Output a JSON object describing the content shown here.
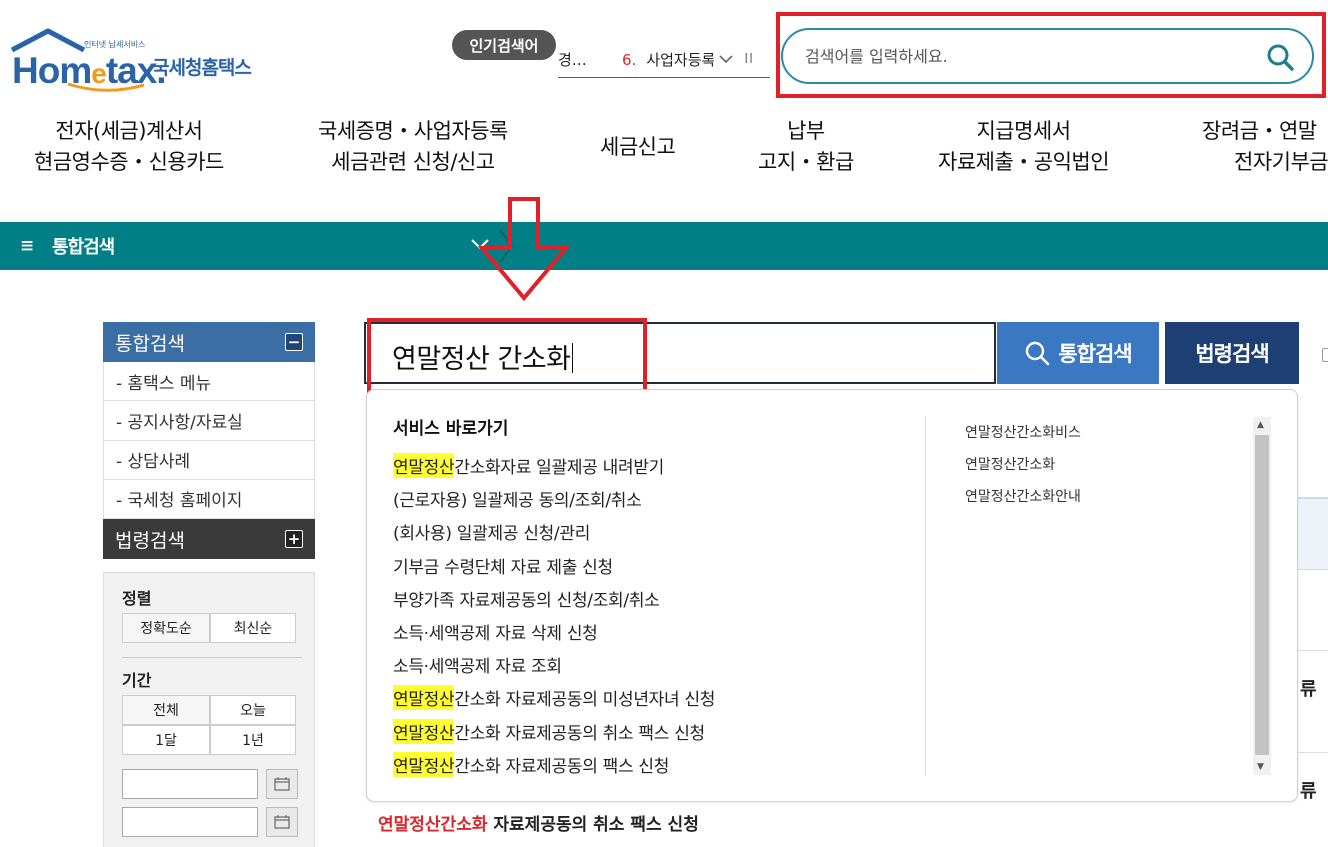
{
  "colors": {
    "brand_blue": "#2a63a8",
    "teal": "#007f86",
    "highlight": "#ffff30",
    "annotation_red": "#e02127"
  },
  "logo": {
    "tagline": "인터넷 납세서비스",
    "wordmark_pre": "Hom",
    "wordmark_e": "e",
    "wordmark_post": "tax.",
    "korean": "국세청홈택스"
  },
  "popular": {
    "badge": "인기검색어",
    "prev_fragment": "경…",
    "rank": "6.",
    "keyword": "사업자등록",
    "pause_label": "II"
  },
  "top_search": {
    "placeholder": "검색어를 입력하세요.",
    "icon": "search-icon"
  },
  "gnb": [
    {
      "line1": "전자(세금)계산서",
      "line2": "현금영수증・신용카드"
    },
    {
      "line1": "국세증명・사업자등록",
      "line2": "세금관련 신청/신고"
    },
    {
      "line1": "세금신고",
      "line2": ""
    },
    {
      "line1": "납부",
      "line2": "고지・환급"
    },
    {
      "line1": "지급명세서",
      "line2": "자료제출・공익법인"
    },
    {
      "line1": "장려금・연말",
      "line2": "전자기부금"
    }
  ],
  "teal_bar": {
    "menu_icon": "≡",
    "title": "통합검색"
  },
  "left_panel": {
    "section1_title": "통합검색",
    "section1_toggle": "−",
    "section1_items": [
      "- 홈택스 메뉴",
      "- 공지사항/자료실",
      "- 상담사례",
      "- 국세청 홈페이지"
    ],
    "section2_title": "법령검색",
    "section2_toggle": "+",
    "sort_label": "정렬",
    "sort_options": [
      "정확도순",
      "최신순"
    ],
    "period_label": "기간",
    "period_options": [
      "전체",
      "오늘",
      "1달",
      "1년"
    ]
  },
  "main_search": {
    "value": "연말정산 간소화",
    "total_search_label": "통합검색",
    "law_search_label": "법령검색"
  },
  "dropdown": {
    "title": "서비스 바로가기",
    "items": [
      {
        "mark": "연말정산",
        "rest": " 간소화자료 일괄제공 내려받기"
      },
      {
        "mark": "",
        "rest": "(근로자용) 일괄제공 동의/조회/취소"
      },
      {
        "mark": "",
        "rest": "(회사용) 일괄제공 신청/관리"
      },
      {
        "mark": "",
        "rest": "기부금 수령단체 자료 제출 신청"
      },
      {
        "mark": "",
        "rest": "부양가족 자료제공동의 신청/조회/취소"
      },
      {
        "mark": "",
        "rest": "소득·세액공제 자료 삭제 신청"
      },
      {
        "mark": "",
        "rest": "소득·세액공제 자료 조회"
      },
      {
        "mark": "연말정산",
        "rest": "간소화 자료제공동의 미성년자녀 신청"
      },
      {
        "mark": "연말정산",
        "rest": "간소화 자료제공동의 취소 팩스 신청"
      },
      {
        "mark": "연말정산",
        "rest": "간소화 자료제공동의 팩스 신청"
      }
    ],
    "suggestions": [
      "연말정산간소화비스",
      "연말정산간소화",
      "연말정산간소화안내"
    ]
  },
  "result_preview": {
    "highlight": "연말정산간소화",
    "rest": " 자료제공동의 취소 팩스 신청"
  },
  "right_edge": {
    "text1": "류 ",
    "text2": "류 "
  }
}
